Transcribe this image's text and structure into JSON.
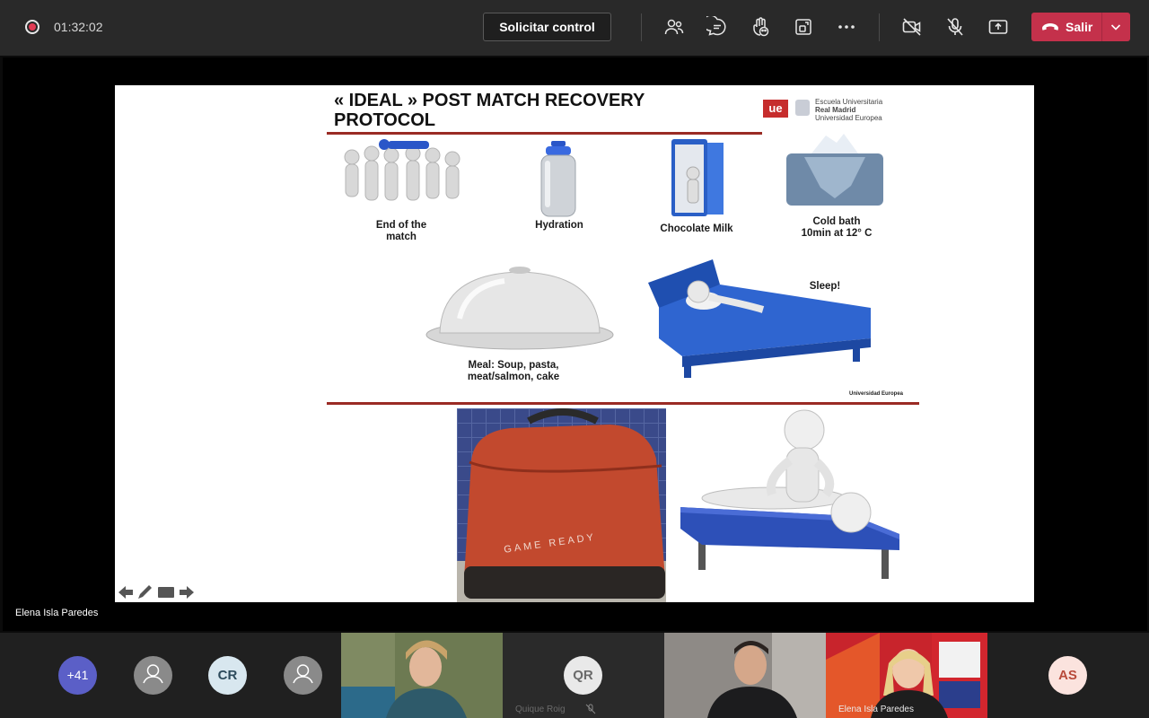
{
  "toolbar": {
    "timer": "01:32:02",
    "request_control_label": "Solicitar control",
    "leave_label": "Salir",
    "icons": [
      "participants-icon",
      "chat-icon",
      "reactions-icon",
      "rooms-icon",
      "more-icon",
      "camera-off-icon",
      "mic-off-icon",
      "share-icon"
    ],
    "leave_color": "#c4314b"
  },
  "slide": {
    "title_line1": "« IDEAL » POST MATCH RECOVERY",
    "title_line2": "PROTOCOL",
    "logo": {
      "mark": "ue",
      "line1": "Escuela Universitaria",
      "line2": "Real Madrid",
      "line3": "Universidad Europea"
    },
    "items": {
      "end_of_match": "End of the\nmatch",
      "hydration": "Hydration",
      "chocolate_milk": "Chocolate Milk",
      "cold_bath": "Cold bath\n10min at 12° C",
      "meal": "Meal: Soup, pasta,\nmeat/salmon, cake",
      "sleep": "Sleep!"
    },
    "footer": "Universidad Europea",
    "bag_brand": "GAME READY"
  },
  "presenter": {
    "name": "Elena Isla Paredes"
  },
  "roster": {
    "overflow_count": "+41",
    "avatars": [
      {
        "initials": "CR",
        "bg": "#d8e7ef",
        "fg": "#2d4b5c"
      },
      {
        "initials": "QR",
        "bg": "#e9e9e9",
        "fg": "#6a6a6a"
      },
      {
        "initials": "AS",
        "bg": "#fbe3de",
        "fg": "#b84a3a"
      }
    ],
    "participants": [
      {
        "name": "Quique Roig"
      },
      {
        "name": "Elena Isla Paredes"
      }
    ]
  }
}
